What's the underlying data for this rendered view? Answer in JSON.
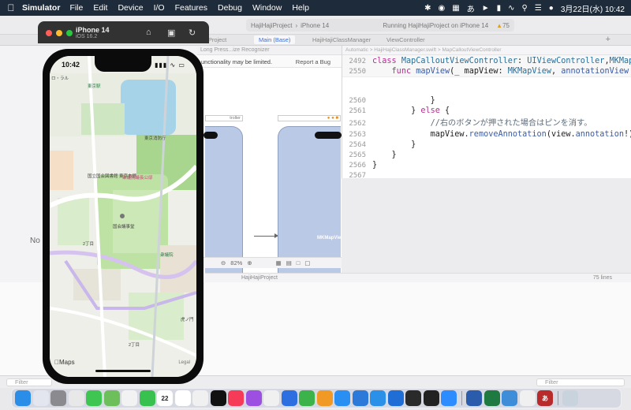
{
  "menubar": {
    "app_name": "Simulator",
    "items": [
      "File",
      "Edit",
      "Device",
      "I/O",
      "Features",
      "Debug",
      "Window",
      "Help"
    ],
    "clock": "3月22日(水) 10:42"
  },
  "xcode": {
    "status": {
      "project": "HajiHajiProject",
      "device": "iPhone 14",
      "running": "Running HajiHajiProject on iPhone 14",
      "warnings": "75"
    },
    "tabs": [
      "HajiHajiProject",
      "Main (Base)",
      "HajiHajiClassManager",
      "ViewController"
    ],
    "no_selection": "No Se",
    "ib": {
      "breadcrumb": "Long Press...ize Recognizer",
      "warning": "unctionality may be limited.",
      "report_bug": "Report a Bug",
      "scene_label": "troller",
      "mkmapview": "MKMapView",
      "zoom": "82%"
    },
    "code": {
      "jumpbar": "Automatic  >  HajiHajiClassManager.swift  >  MapCalloutViewController",
      "sticky_lines": [
        {
          "num": "2492",
          "text": "class MapCalloutViewController: UIViewController,MKMap"
        },
        {
          "num": "2550",
          "text": "    func mapView(_ mapView: MKMapView, annotationView"
        }
      ],
      "lines": [
        {
          "num": "2560",
          "text": "            }"
        },
        {
          "num": "2561",
          "text": "        } else {"
        },
        {
          "num": "2562",
          "text": "            //右のボタンが押された場合はピンを消す。"
        },
        {
          "num": "2563",
          "text": "            mapView.removeAnnotation(view.annotation!)"
        },
        {
          "num": "2564",
          "text": "        }"
        },
        {
          "num": "2565",
          "text": "    }"
        },
        {
          "num": "2566",
          "text": "}"
        },
        {
          "num": "2567",
          "text": ""
        }
      ],
      "footer_project": "HajiHajiProject",
      "line_count": "75 lines"
    },
    "filter_placeholder": "Filter"
  },
  "simulator": {
    "device": "iPhone 14",
    "os": "iOS 16.2",
    "time": "10:42",
    "maps_logo": "Maps",
    "legal": "Legal",
    "map_labels": [
      "ロ・ラル",
      "東京駅",
      "東京消防庁",
      "国立国会図書館 東京本館",
      "衆議院議長公邸",
      "国会議事堂",
      "2丁目",
      "衆議院",
      "虎ノ門",
      "2丁目"
    ]
  },
  "dock": {
    "apps": [
      {
        "name": "finder",
        "color": "#2a8ee8"
      },
      {
        "name": "launchpad",
        "color": "#e3e6ee"
      },
      {
        "name": "system-settings",
        "color": "#8a8a8f"
      },
      {
        "name": "chrome",
        "color": "#e8e8e8"
      },
      {
        "name": "messages",
        "color": "#3fc552"
      },
      {
        "name": "maps",
        "color": "#6cbf5a"
      },
      {
        "name": "photos",
        "color": "#f2f2f2"
      },
      {
        "name": "facetime",
        "color": "#39c150"
      },
      {
        "name": "calendar",
        "color": "#ffffff"
      },
      {
        "name": "reminders",
        "color": "#ffffff"
      },
      {
        "name": "freeform",
        "color": "#f0f0f0"
      },
      {
        "name": "tv",
        "color": "#111111"
      },
      {
        "name": "music",
        "color": "#f53b57"
      },
      {
        "name": "podcasts",
        "color": "#9c4fe0"
      },
      {
        "name": "news",
        "color": "#f0f0f0"
      },
      {
        "name": "keynote",
        "color": "#2d6fe0"
      },
      {
        "name": "numbers",
        "color": "#3cb24a"
      },
      {
        "name": "pages",
        "color": "#f09a25"
      },
      {
        "name": "app-store",
        "color": "#2a8ff2"
      },
      {
        "name": "xcode",
        "color": "#2b79d9"
      },
      {
        "name": "simulator",
        "color": "#2a90e8"
      },
      {
        "name": "instruments",
        "color": "#1f6ed6"
      },
      {
        "name": "activity-monitor",
        "color": "#2a2a2a"
      },
      {
        "name": "terminal",
        "color": "#222222"
      },
      {
        "name": "zoom",
        "color": "#2d8cff"
      },
      {
        "name": "word",
        "color": "#2b5cab"
      },
      {
        "name": "excel",
        "color": "#1f7a42"
      },
      {
        "name": "preview",
        "color": "#3e8dd8"
      },
      {
        "name": "textedit",
        "color": "#f0f0f0"
      },
      {
        "name": "dictionary",
        "color": "#b92a2a"
      },
      {
        "name": "trash",
        "color": "#c9d3de"
      }
    ],
    "dictionary_glyph": "あ",
    "calendar_day": "22"
  }
}
